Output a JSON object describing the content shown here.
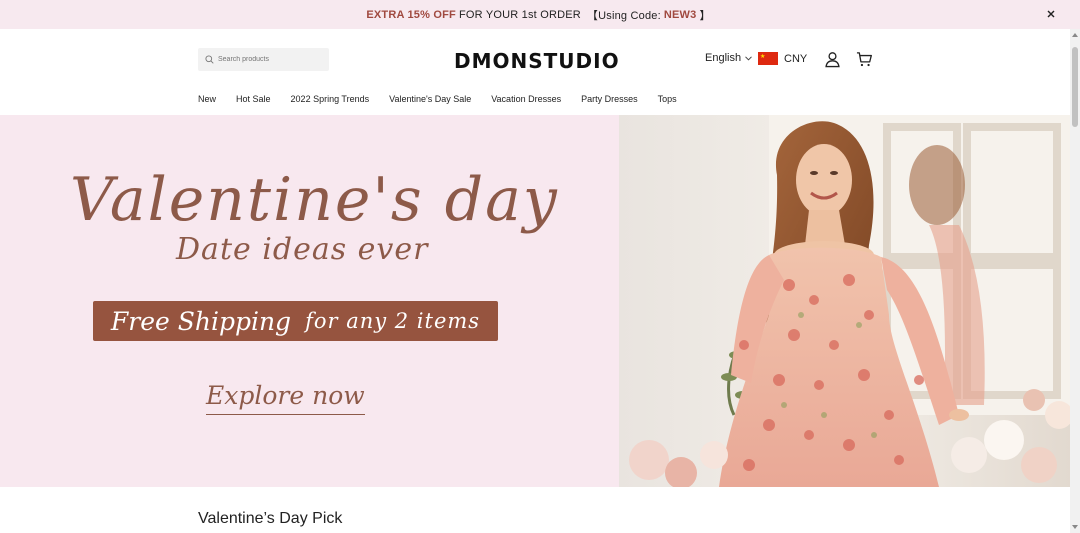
{
  "announcement": {
    "highlight": "EXTRA 15% OFF",
    "middle": "FOR YOUR 1st ORDER",
    "code_prefix": "【Using Code:",
    "code": "NEW3",
    "code_suffix": "】",
    "close_icon": "close-icon"
  },
  "header": {
    "search_placeholder": "Search products",
    "logo": "DMONSTUDIO",
    "language": "English",
    "currency": "CNY",
    "flag_icon": "china-flag-icon",
    "account_icon": "user-icon",
    "cart_icon": "cart-icon"
  },
  "nav": {
    "items": [
      "New",
      "Hot Sale",
      "2022 Spring Trends",
      "Valentine's Day Sale",
      "Vacation Dresses",
      "Party Dresses",
      "Tops"
    ]
  },
  "hero": {
    "title": "Valentine's day",
    "subtitle": "Date ideas ever",
    "shipping_part1": "Free Shipping",
    "shipping_part2": "for any 2 items",
    "cta": "Explore now",
    "background_color": "#f8e8ef",
    "accent_color": "#8d5a49",
    "banner_color": "#96543f"
  },
  "section": {
    "title": "Valentine’s Day Pick"
  }
}
